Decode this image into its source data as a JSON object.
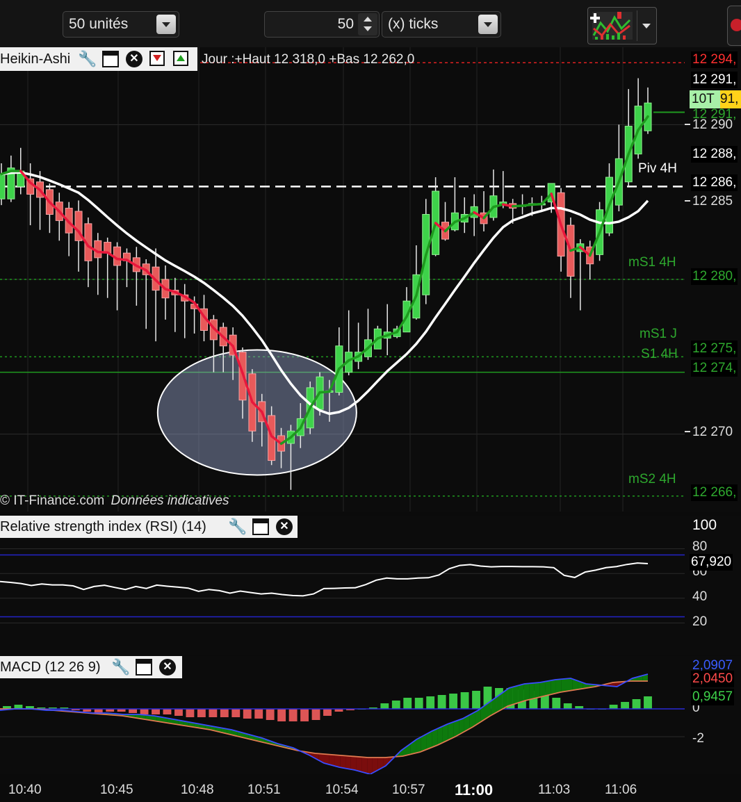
{
  "toolbar": {
    "units_select": "50 unités",
    "ticks_value": "50",
    "ticks_select": "(x) ticks"
  },
  "main_pane": {
    "title": "Heikin-Ashi",
    "day_info": "Jour :+Haut 12 318,0 +Bas 12 262,0",
    "copyright": "© IT-Finance.com",
    "disclaimer": "Données indicatives",
    "level_labels": {
      "piv": "Piv 4H",
      "ms1_4h": "mS1 4H",
      "ms1_j": "mS1 J",
      "s1_4h": "S1 4H",
      "ms2_4h": "mS2 4H"
    },
    "axis_ticks": [
      "12 290",
      "12 285",
      "12 270"
    ],
    "price_tags": {
      "red_level": "12 294,",
      "high": "12 291,",
      "last_prefix": "10T",
      "last_value": "91,",
      "green_line": "12 291,",
      "p288": "12 288,",
      "piv": "12 286,",
      "ms1_4h": "12 280,",
      "ms1_j": "12 275,",
      "s1_4h": "12 274,",
      "ms2_4h": "12 266,"
    }
  },
  "rsi_pane": {
    "title": "Relative strength index (RSI) (14)",
    "axis_ticks": [
      "100",
      "80",
      "60",
      "40",
      "20"
    ],
    "current": "67,920"
  },
  "macd_pane": {
    "title": "MACD (12 26 9)",
    "axis_ticks": [
      "0",
      "-2"
    ],
    "value_blue": "2,0907",
    "value_red": "2,0450",
    "value_hist": "0,9457"
  },
  "time_axis": [
    "10:40",
    "10:45",
    "10:48",
    "10:51",
    "10:54",
    "10:57",
    "11:00",
    "11:03",
    "11:06"
  ],
  "chart_data": {
    "type": "candlestick",
    "title": "Heikin-Ashi",
    "candles": [
      [
        12285.2,
        12286.8,
        12284.8,
        12287.5
      ],
      [
        12285.2,
        12287.2,
        12285.0,
        12288.0
      ],
      [
        12286.0,
        12287.0,
        12285.5,
        12288.5
      ],
      [
        12286.5,
        12285.5,
        12283.5,
        12287.5
      ],
      [
        12286.3,
        12285.3,
        12283.2,
        12287.0
      ],
      [
        12285.8,
        12284.2,
        12283.0,
        12286.2
      ],
      [
        12285.0,
        12283.8,
        12282.5,
        12285.6
      ],
      [
        12284.6,
        12283.0,
        12281.5,
        12285.0
      ],
      [
        12284.4,
        12282.5,
        12280.5,
        12285.1
      ],
      [
        12283.6,
        12281.2,
        12279.5,
        12284.0
      ],
      [
        12282.5,
        12281.4,
        12279.0,
        12283.0
      ],
      [
        12282.4,
        12281.7,
        12278.8,
        12282.7
      ],
      [
        12282.1,
        12280.9,
        12278.0,
        12282.4
      ],
      [
        12281.7,
        12281.2,
        12279.5,
        12282.0
      ],
      [
        12281.4,
        12280.5,
        12278.3,
        12282.1
      ],
      [
        12281.0,
        12280.3,
        12276.8,
        12281.3
      ],
      [
        12280.8,
        12279.3,
        12276.0,
        12282.0
      ],
      [
        12280.0,
        12278.8,
        12277.4,
        12280.9
      ],
      [
        12279.3,
        12279.0,
        12276.6,
        12280.1
      ],
      [
        12279.0,
        12278.6,
        12276.2,
        12279.7
      ],
      [
        12278.4,
        12278.1,
        12276.5,
        12278.9
      ],
      [
        12278.1,
        12276.7,
        12276.0,
        12279.0
      ],
      [
        12277.4,
        12276.1,
        12274.0,
        12277.7
      ],
      [
        12276.9,
        12275.7,
        12274.0,
        12277.2
      ],
      [
        12276.4,
        12275.1,
        12273.5,
        12276.9
      ],
      [
        12275.3,
        12272.2,
        12271.0,
        12275.6
      ],
      [
        12273.9,
        12270.2,
        12269.5,
        12274.2
      ],
      [
        12272.1,
        12270.8,
        12269.2,
        12272.6
      ],
      [
        12271.2,
        12268.3,
        12268.0,
        12271.8
      ],
      [
        12269.9,
        12268.9,
        12267.8,
        12270.4
      ],
      [
        12269.4,
        12270.2,
        12266.4,
        12270.6
      ],
      [
        12269.9,
        12271.0,
        12269.1,
        12272.0
      ],
      [
        12270.4,
        12273.0,
        12270.0,
        12273.4
      ],
      [
        12271.6,
        12273.7,
        12271.2,
        12274.0
      ],
      [
        12272.7,
        12272.8,
        12270.8,
        12273.5
      ],
      [
        12272.7,
        12275.7,
        12272.5,
        12276.9
      ],
      [
        12274.0,
        12275.3,
        12273.8,
        12278.0
      ],
      [
        12274.7,
        12275.3,
        12274.2,
        12277.2
      ],
      [
        12275.0,
        12276.1,
        12274.8,
        12278.1
      ],
      [
        12275.5,
        12276.8,
        12275.6,
        12277.0
      ],
      [
        12276.2,
        12276.6,
        12275.1,
        12278.4
      ],
      [
        12276.3,
        12276.8,
        12276.2,
        12277.0
      ],
      [
        12276.6,
        12278.6,
        12276.6,
        12279.5
      ],
      [
        12277.5,
        12280.3,
        12277.4,
        12282.2
      ],
      [
        12279.0,
        12284.2,
        12278.4,
        12285.2
      ],
      [
        12281.6,
        12285.7,
        12281.5,
        12286.6
      ],
      [
        12283.7,
        12282.6,
        12282.5,
        12285.0
      ],
      [
        12283.2,
        12284.3,
        12283.1,
        12286.6
      ],
      [
        12283.7,
        12284.2,
        12283.0,
        12285.3
      ],
      [
        12284.0,
        12284.7,
        12282.8,
        12285.5
      ],
      [
        12284.3,
        12283.6,
        12283.1,
        12285.7
      ],
      [
        12284.0,
        12285.4,
        12283.8,
        12287.1
      ],
      [
        12284.8,
        12285.0,
        12284.6,
        12287.0
      ],
      [
        12284.9,
        12284.6,
        12283.6,
        12285.2
      ],
      [
        12284.8,
        12284.8,
        12284.2,
        12285.5
      ],
      [
        12284.8,
        12284.9,
        12284.1,
        12285.3
      ],
      [
        12284.9,
        12284.9,
        12284.4,
        12285.4
      ],
      [
        12285.0,
        12286.2,
        12284.3,
        12285.1
      ],
      [
        12285.6,
        12281.5,
        12280.5,
        12285.9
      ],
      [
        12283.5,
        12280.2,
        12278.8,
        12284.0
      ],
      [
        12281.8,
        12282.3,
        12278.0,
        12282.6
      ],
      [
        12282.1,
        12281.0,
        12280.0,
        12282.5
      ],
      [
        12281.6,
        12284.5,
        12281.2,
        12285.0
      ],
      [
        12283.0,
        12286.6,
        12282.8,
        12287.5
      ],
      [
        12284.8,
        12287.8,
        12284.4,
        12290.0
      ],
      [
        12286.3,
        12289.9,
        12286.0,
        12292.3
      ],
      [
        12288.1,
        12291.2,
        12287.8,
        12293.0
      ],
      [
        12289.6,
        12291.4,
        12289.4,
        12292.4
      ]
    ],
    "candle_format": "open, close, low, high",
    "levels": {
      "red_level": 12294.0,
      "piv_4h": 12286.0,
      "ms1_4h": 12280.0,
      "ms1_j": 12275.0,
      "s1_4h": 12274.0,
      "ms2_4h": 12266.0,
      "green_line": 12290.8
    },
    "ylim": [
      12265.0,
      12295.0
    ],
    "rsi": [
      53.5,
      52.8,
      51.9,
      50.3,
      51.6,
      50.8,
      50.8,
      50.0,
      47.1,
      49.5,
      50.5,
      48.7,
      47.1,
      49.5,
      47.9,
      50.6,
      49.7,
      49.0,
      48.2,
      45.6,
      47.1,
      46.1,
      44.1,
      45.8,
      44.6,
      43.5,
      44.1,
      43.0,
      42.2,
      41.9,
      43.5,
      47.8,
      48.0,
      48.3,
      48.5,
      51.0,
      54.6,
      56.3,
      55.7,
      55.7,
      56.3,
      56.6,
      58.8,
      63.9,
      66.5,
      67.2,
      66.0,
      65.4,
      65.7,
      65.7,
      65.5,
      65.5,
      65.4,
      64.7,
      58.5,
      56.8,
      61.2,
      62.7,
      64.7,
      65.6,
      67.3,
      68.5,
      68.0
    ],
    "rsi_levels": [
      75,
      25
    ],
    "macd_line": [
      -0.1,
      0.0,
      0.0,
      -0.1,
      -0.1,
      -0.2,
      -0.3,
      -0.3,
      -0.4,
      -0.4,
      -0.5,
      -0.7,
      -0.9,
      -1.1,
      -1.3,
      -1.5,
      -1.8,
      -2.1,
      -2.5,
      -2.8,
      -3.3,
      -3.9,
      -4.2,
      -4.4,
      -4.7,
      -4.1,
      -3.0,
      -2.2,
      -1.6,
      -1.1,
      -0.7,
      -0.1,
      0.7,
      1.5,
      1.8,
      1.9,
      2.1,
      2.2,
      1.8,
      1.7,
      1.6,
      2.2,
      2.5
    ],
    "signal_line": [
      0.0,
      0.0,
      0.0,
      -0.1,
      -0.2,
      -0.3,
      -0.4,
      -0.5,
      -0.7,
      -0.9,
      -1.1,
      -1.3,
      -1.5,
      -1.8,
      -2.1,
      -2.4,
      -2.7,
      -3.0,
      -3.2,
      -3.3,
      -3.4,
      -3.5,
      -3.5,
      -3.4,
      -3.1,
      -2.6,
      -2.0,
      -1.3,
      -0.5,
      0.2,
      0.6,
      0.9,
      1.2,
      1.4,
      1.6,
      1.9,
      2.0,
      2.0
    ],
    "macd_hist": [
      0.2,
      0.3,
      0.2,
      0.1,
      0.1,
      0.1,
      -0.1,
      -0.2,
      -0.3,
      -0.2,
      -0.2,
      -0.3,
      -0.4,
      -0.4,
      -0.4,
      -0.5,
      -0.6,
      -0.6,
      -0.6,
      -0.6,
      -0.6,
      -0.7,
      -0.7,
      -0.8,
      -0.9,
      -0.9,
      -0.9,
      -0.8,
      -0.5,
      -0.2,
      -0.1,
      0.0,
      0.1,
      0.4,
      0.6,
      0.8,
      0.8,
      0.9,
      1.0,
      1.1,
      1.2,
      1.3,
      1.6,
      1.5,
      1.5,
      1.4,
      1.3,
      1.2,
      0.8,
      0.4,
      0.2,
      0.0,
      0.0,
      0.3,
      0.5,
      0.7,
      0.9
    ],
    "colors": {
      "bull": "#3ed24a",
      "bear": "#e85a5a",
      "ma_fast_up": "#1e9a1e",
      "ma_fast_down": "#e8183c",
      "ma_slow": "#ffffff",
      "rsi_band": "#2323c8"
    }
  }
}
